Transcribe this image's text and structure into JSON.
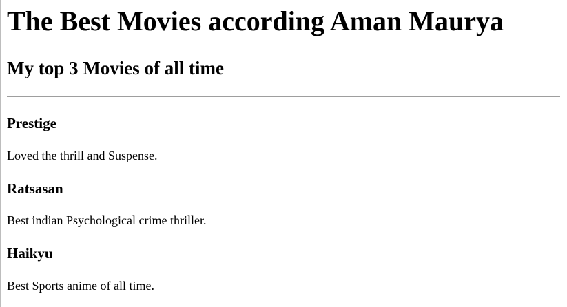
{
  "page": {
    "heading": "The Best Movies according Aman Maurya",
    "subheading": "My top 3 Movies of all time"
  },
  "movies": [
    {
      "title": "Prestige",
      "description": "Loved the thrill and Suspense."
    },
    {
      "title": "Ratsasan",
      "description": "Best indian Psychological crime thriller."
    },
    {
      "title": "Haikyu",
      "description": "Best Sports anime of all time."
    }
  ]
}
